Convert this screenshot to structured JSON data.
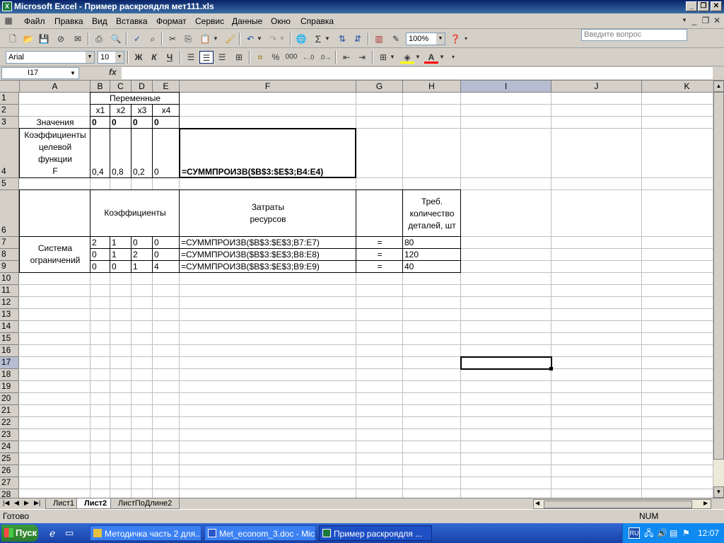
{
  "window": {
    "title": "Microsoft Excel - Пример раскроядля мет111.xls",
    "app_icon": "X"
  },
  "menu": {
    "items": [
      "Файл",
      "Правка",
      "Вид",
      "Вставка",
      "Формат",
      "Сервис",
      "Данные",
      "Окно",
      "Справка"
    ],
    "help_placeholder": "Введите вопрос"
  },
  "toolbar": {
    "zoom": "100%"
  },
  "format_toolbar": {
    "font": "Arial",
    "size": "10",
    "bold": "Ж",
    "italic": "К",
    "underline": "Ч",
    "percent": "%",
    "thousands": "000",
    "font_color": "A"
  },
  "formula_bar": {
    "name_box": "I17",
    "fx": "fx",
    "value": ""
  },
  "columns": [
    "A",
    "B",
    "C",
    "D",
    "E",
    "F",
    "G",
    "H",
    "I",
    "J",
    "K"
  ],
  "rows": [
    "1",
    "2",
    "3",
    "4",
    "5",
    "6",
    "7",
    "8",
    "9",
    "10",
    "11",
    "12",
    "13",
    "14",
    "15",
    "16",
    "17",
    "18",
    "19",
    "20",
    "21",
    "22",
    "23",
    "24",
    "25",
    "26",
    "27",
    "28"
  ],
  "cells": {
    "b1": "Переменные",
    "b2": "x1",
    "c2": "x2",
    "d2": "x3",
    "e2": "x4",
    "a3": "Значения",
    "b3": "0",
    "c3": "0",
    "d3": "0",
    "e3": "0",
    "a4_l1": "Коэффициенты",
    "a4_l2": "целевой",
    "a4_l3": "функции",
    "a4_l4": "F",
    "b4": "0,4",
    "c4": "0,8",
    "d4": "0,2",
    "e4": "0",
    "f4": "=СУММПРОИЗВ($B$3:$E$3;B4:E4)",
    "b6": "Коэффициенты",
    "f6_l1": "Затраты",
    "f6_l2": "ресурсов",
    "h6_l1": "Треб.",
    "h6_l2": "количество",
    "h6_l3": "деталей, шт",
    "a7_l1": "Система",
    "a7_l2": "ограничений",
    "b7": "2",
    "c7": "1",
    "d7": "0",
    "e7": "0",
    "f7": "=СУММПРОИЗВ($B$3:$E$3;B7:E7)",
    "g7": "=",
    "h7": "80",
    "b8": "0",
    "c8": "1",
    "d8": "2",
    "e8": "0",
    "f8": "=СУММПРОИЗВ($B$3:$E$3;B8:E8)",
    "g8": "=",
    "h8": "120",
    "b9": "0",
    "c9": "0",
    "d9": "1",
    "e9": "4",
    "f9": "=СУММПРОИЗВ($B$3:$E$3;B9:E9)",
    "g9": "=",
    "h9": "40"
  },
  "sheets": [
    "Лист1",
    "Лист2",
    "ЛистПоДлине2"
  ],
  "active_sheet": "Лист2",
  "status": {
    "left": "Готово",
    "num": "NUM"
  },
  "taskbar": {
    "start": "Пуск",
    "tasks": [
      "Методичка часть 2 для...",
      "Met_econom_3.doc - Mic...",
      "Пример раскроядля ..."
    ],
    "lang": "RU",
    "time": "12:07"
  }
}
